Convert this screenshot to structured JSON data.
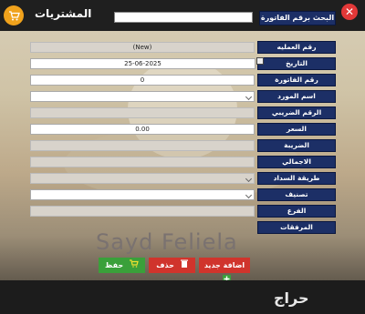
{
  "window": {
    "title": "المشتريات"
  },
  "search": {
    "button_label": "البحث برقم الفاتورة"
  },
  "form": {
    "rows": [
      {
        "label": "رقم العمليه",
        "value": "(New)"
      },
      {
        "label": "التاريخ",
        "value": "25-06-2025"
      },
      {
        "label": "رقم الفاتورة",
        "value": "0"
      },
      {
        "label": "اسم المورد",
        "value": ""
      },
      {
        "label": "الرقم الضريبي",
        "value": ""
      },
      {
        "label": "السعر",
        "value": "0.00"
      },
      {
        "label": "الضريبة",
        "value": ""
      },
      {
        "label": "الاجمالي",
        "value": ""
      },
      {
        "label": "طريقة السداد",
        "value": ""
      },
      {
        "label": "تصنيف",
        "value": ""
      },
      {
        "label": "الفرع",
        "value": ""
      },
      {
        "label": "المرفقات",
        "value": ""
      }
    ]
  },
  "watermark": {
    "name": "Sayd Feliela"
  },
  "actions": {
    "add_label": "اضافة جديد",
    "delete_label": "حذف",
    "save_label": "حفظ"
  },
  "footer": {
    "brand": "حراج"
  },
  "colors": {
    "label_bg": "#1c2f66",
    "add": "#d0342c",
    "delete": "#d0342c",
    "save": "#3aa03a",
    "cart": "#f0a21c"
  }
}
